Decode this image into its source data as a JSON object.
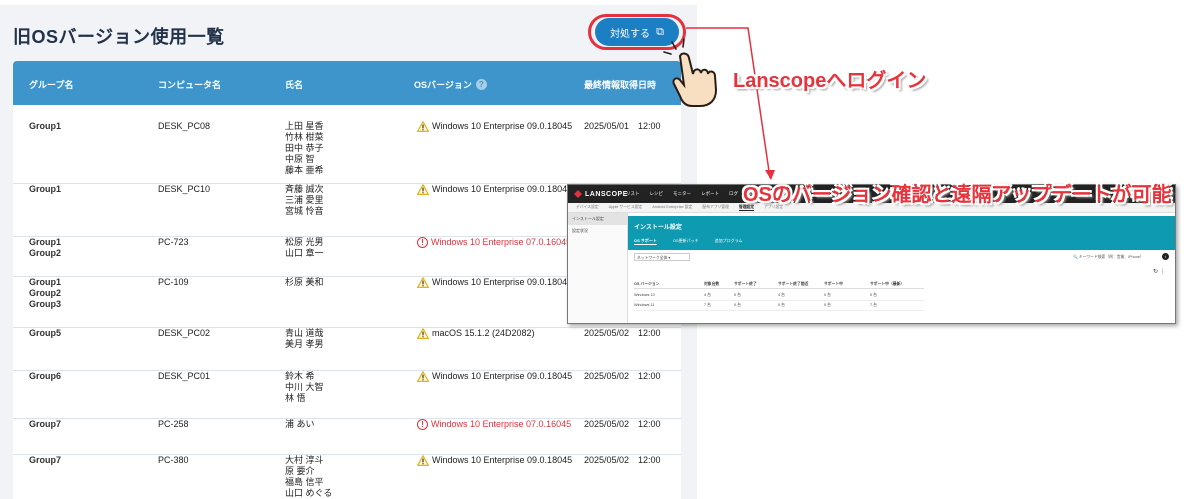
{
  "page": {
    "title": "旧OSバージョン使用一覧",
    "action_button": {
      "label": "対処する",
      "icon": "external-link-icon"
    }
  },
  "table": {
    "headers": [
      "グループ名",
      "コンピュータ名",
      "氏名",
      "OSバージョン",
      "最終情報取得日時"
    ],
    "rows": [
      {
        "group": "Group1",
        "pc": "DESK_PC08",
        "names": "上田 星香\n竹林 柑菜\n田中 恭子\n中原 智\n藤本 亜希",
        "os": "Windows 10 Enterprise 09.0.18045",
        "status": "warning",
        "date": "2025/05/01　12:00"
      },
      {
        "group": "Group1",
        "pc": "DESK_PC10",
        "names": "斉藤 誠次\n三浦 愛里\n宮城 怜音",
        "os": "Windows 10 Enterprise 09.0.18045",
        "status": "warning",
        "date": ""
      },
      {
        "group": "Group1\nGroup2",
        "pc": "PC-723",
        "names": "松原 光男\n山口 章一",
        "os": "Windows 10 Enterprise 07.0.16045",
        "status": "danger",
        "date": ""
      },
      {
        "group": "Group1\nGroup2\nGroup3",
        "pc": "PC-109",
        "names": "杉原 美和",
        "os": "Windows 10 Enterprise 09.0.18045",
        "status": "warning",
        "date": ""
      },
      {
        "group": "Group5",
        "pc": "DESK_PC02",
        "names": "青山 道哉\n美月 孝男",
        "os": "macOS 15.1.2 (24D2082)",
        "status": "warning",
        "date": "2025/05/02　12:00"
      },
      {
        "group": "Group6",
        "pc": "DESK_PC01",
        "names": "鈴木 希\n中川 大智\n林 悟",
        "os": "Windows 10 Enterprise 09.0.18045",
        "status": "warning",
        "date": "2025/05/02　12:00"
      },
      {
        "group": "Group7",
        "pc": "PC-258",
        "names": "浦 あい",
        "os": "Windows 10 Enterprise 07.0.16045",
        "status": "danger",
        "date": "2025/05/02　12:00"
      },
      {
        "group": "Group7",
        "pc": "PC-380",
        "names": "大村 淳斗\n原 要介\n福島 信平\n山口 めぐる",
        "os": "Windows 10 Enterprise 09.0.18045",
        "status": "warning",
        "date": "2025/05/02　12:00"
      }
    ]
  },
  "annotations": {
    "login": "Lanscopeへログイン",
    "os_update": "OSのバージョン確認と遠隔アップデートが可能"
  },
  "inset": {
    "logo": "LANSCOPE",
    "nav": [
      "リスト",
      "レシピ",
      "モニター",
      "レポート",
      "ログ",
      "ル"
    ],
    "subnav": [
      "デバイス設定",
      "Apple サービス設定",
      "Android Enterprise 設定",
      "配布アプリ管理",
      "管理設定",
      "アプリ設定"
    ],
    "sidebar": [
      "インストール設定",
      "設定状況"
    ],
    "header_title": "インストール設定",
    "tabs": [
      "OS サポート",
      "OS更新パッチ",
      "追加プログラム"
    ],
    "filter": "ネットワーク全体",
    "search_placeholder": "キーワード検索（例：営業、iPhone）",
    "columns": [
      "OS バージョン",
      "対象台数",
      "サポート終了",
      "サポート終了間近",
      "サポート中",
      "サポート中（最新）"
    ],
    "rows": [
      [
        "Windows 10",
        "4 台",
        "0 台",
        "4 台",
        "0 台",
        "0 台"
      ],
      [
        "Windows 11",
        "7 台",
        "0 台",
        "0 台",
        "0 台",
        "7 台"
      ]
    ]
  },
  "colors": {
    "header_bg": "#3d95cc",
    "accent_red": "#e53040",
    "warning": "#e8b21a",
    "inset_teal": "#0e9ab1"
  }
}
